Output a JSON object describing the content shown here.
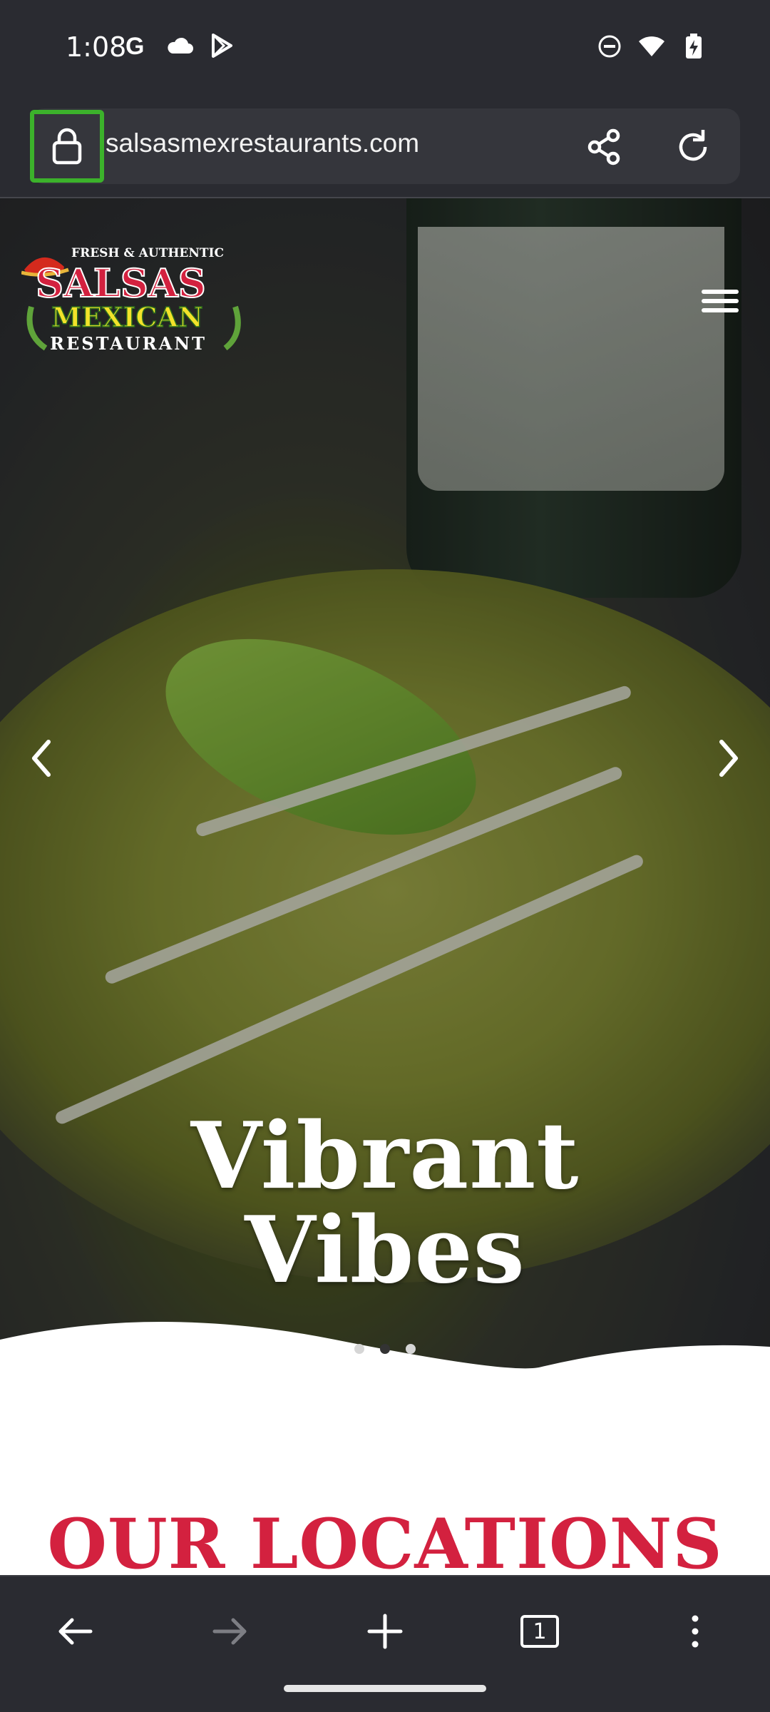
{
  "status_bar": {
    "time": "1:08",
    "left_icons": [
      "google-icon",
      "cloud-icon",
      "play-store-icon"
    ],
    "right_icons": [
      "do-not-disturb-icon",
      "wifi-icon",
      "battery-charging-icon"
    ]
  },
  "url_bar": {
    "url": "salsasmexrestaurants.com",
    "lock_icon": "lock-icon",
    "share_icon": "share-icon",
    "reload_icon": "reload-icon",
    "highlight_color": "#3cb22b"
  },
  "hero": {
    "logo": {
      "tagline": "FRESH & AUTHENTIC",
      "name_line1": "SALSAS",
      "name_line2": "MEXICAN",
      "name_line3": "RESTAURANT"
    },
    "menu_icon": "hamburger-menu-icon",
    "title_line1": "Vibrant",
    "title_line2": "Vibes",
    "prev_icon": "chevron-left-icon",
    "next_icon": "chevron-right-icon",
    "carousel_dots": 3,
    "active_dot": 2
  },
  "content": {
    "locations_heading": "OUR LOCATIONS",
    "heading_color": "#d3213f"
  },
  "bottom_nav": {
    "back_icon": "back-arrow-icon",
    "forward_icon": "forward-arrow-icon",
    "new_tab_icon": "plus-icon",
    "tab_count": "1",
    "more_icon": "more-vert-icon"
  }
}
